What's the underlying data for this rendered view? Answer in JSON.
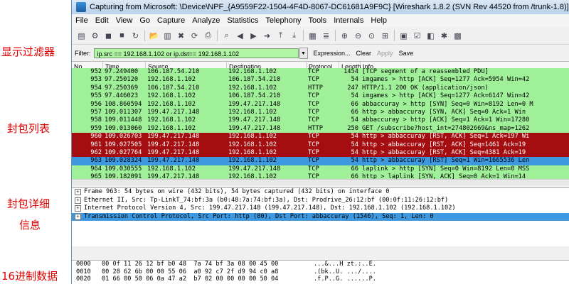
{
  "annotations": {
    "filter": "显示过滤器",
    "list": "封包列表",
    "detail_1": "封包详细",
    "detail_2": "信息",
    "hex": "16进制数据"
  },
  "window": {
    "title": "Capturing from Microsoft: \\Device\\NPF_{A9559F22-1504-4F4D-8067-DC61681A9F9C}   [Wireshark 1.8.2  (SVN Rev 44520 from /trunk-1.8)]"
  },
  "menu": [
    "File",
    "Edit",
    "View",
    "Go",
    "Capture",
    "Analyze",
    "Statistics",
    "Telephony",
    "Tools",
    "Internals",
    "Help"
  ],
  "toolbar_icons": [
    "interface-list-icon",
    "capture-options-icon",
    "start-capture-icon",
    "stop-capture-icon",
    "restart-capture-icon",
    "open-file-icon",
    "save-file-icon",
    "close-file-icon",
    "reload-icon",
    "print-icon",
    "find-packet-icon",
    "go-back-icon",
    "go-forward-icon",
    "go-to-packet-icon",
    "go-first-icon",
    "go-last-icon",
    "colorize-icon",
    "auto-scroll-icon",
    "zoom-in-icon",
    "zoom-out-icon",
    "normal-size-icon",
    "resize-columns-icon",
    "capture-filters-icon",
    "display-filters-icon",
    "coloring-rules-icon",
    "preferences-icon",
    "help-icon"
  ],
  "filter": {
    "label": "Filter:",
    "value": "ip.src == 192.168.1.102 or ip.dst== 192.168.1.102",
    "expression": "Expression...",
    "clear": "Clear",
    "apply": "Apply",
    "save": "Save",
    "input_bg": "#aff5a4"
  },
  "columns": [
    "No.",
    "Time",
    "Source",
    "Destination",
    "Protocol",
    "Length",
    "Info"
  ],
  "row_colors": {
    "green": "#a0f09a",
    "red": "#a50e10",
    "blue": "#3d98e0"
  },
  "packets": [
    {
      "no": "952",
      "time": "97.249400",
      "src": "106.187.54.210",
      "dst": "192.168.1.102",
      "proto": "TCP",
      "len": "1454",
      "info": "[TCP segment of a reassembled PDU]",
      "color": "green"
    },
    {
      "no": "953",
      "time": "97.250120",
      "src": "192.168.1.102",
      "dst": "106.187.54.210",
      "proto": "TCP",
      "len": "54",
      "info": "imgames > http [ACK] Seq=1277 Ack=5954 Win=42",
      "color": "green"
    },
    {
      "no": "954",
      "time": "97.250369",
      "src": "106.187.54.210",
      "dst": "192.168.1.102",
      "proto": "HTTP",
      "len": "247",
      "info": "HTTP/1.1 200 OK  (application/json)",
      "color": "green"
    },
    {
      "no": "955",
      "time": "97.446023",
      "src": "192.168.1.102",
      "dst": "106.187.54.210",
      "proto": "TCP",
      "len": "54",
      "info": "imgames > http [ACK] Seq=1277 Ack=6147 Win=42",
      "color": "green"
    },
    {
      "no": "956",
      "time": "108.860594",
      "src": "192.168.1.102",
      "dst": "199.47.217.148",
      "proto": "TCP",
      "len": "66",
      "info": "abbaccuray > http [SYN] Seq=0 Win=8192 Len=0 M",
      "color": "green"
    },
    {
      "no": "957",
      "time": "109.011307",
      "src": "199.47.217.148",
      "dst": "192.168.1.102",
      "proto": "TCP",
      "len": "66",
      "info": "http > abbaccuray [SYN, ACK] Seq=0 Ack=1 Win",
      "color": "green"
    },
    {
      "no": "958",
      "time": "109.011448",
      "src": "192.168.1.102",
      "dst": "199.47.217.148",
      "proto": "TCP",
      "len": "54",
      "info": "abbaccuray > http [ACK] Seq=1 Ack=1 Win=17280",
      "color": "green"
    },
    {
      "no": "959",
      "time": "109.013060",
      "src": "192.168.1.102",
      "dst": "199.47.217.148",
      "proto": "HTTP",
      "len": "250",
      "info": "GET /subscribe?host_int=274802669&ns_map=1262",
      "color": "green"
    },
    {
      "no": "960",
      "time": "109.026703",
      "src": "199.47.217.148",
      "dst": "192.168.1.102",
      "proto": "TCP",
      "len": "54",
      "info": "http > abbaccuray [RST, ACK] Seq=1 Ack=197 Wi",
      "color": "red"
    },
    {
      "no": "961",
      "time": "109.027505",
      "src": "199.47.217.148",
      "dst": "192.168.1.102",
      "proto": "TCP",
      "len": "54",
      "info": "http > abbaccuray [RST, ACK] Seq=1461 Ack=19",
      "color": "red"
    },
    {
      "no": "962",
      "time": "109.027764",
      "src": "199.47.217.148",
      "dst": "192.168.1.102",
      "proto": "TCP",
      "len": "54",
      "info": "http > abbaccuray [RST, ACK] Seq=4381 Ack=19",
      "color": "red"
    },
    {
      "no": "963",
      "time": "109.028324",
      "src": "199.47.217.148",
      "dst": "192.168.1.102",
      "proto": "TCP",
      "len": "54",
      "info": "http > abbaccuray [RST] Seq=1 Win=1665536 Len",
      "color": "blue"
    },
    {
      "no": "964",
      "time": "109.030555",
      "src": "192.168.1.102",
      "dst": "199.47.217.148",
      "proto": "TCP",
      "len": "66",
      "info": "laplink > http [SYN] Seq=0 Win=8192 Len=0 MSS",
      "color": "green"
    },
    {
      "no": "965",
      "time": "109.182091",
      "src": "199.47.217.148",
      "dst": "192.168.1.102",
      "proto": "TCP",
      "len": "66",
      "info": "http > laplink [SYN, ACK] Seq=0 Ack=1 Win=14",
      "color": "green"
    }
  ],
  "details": [
    {
      "text": "Frame 963: 54 bytes on wire (432 bits), 54 bytes captured (432 bits) on interface 0",
      "selected": false
    },
    {
      "text": "Ethernet II, Src: Tp-LinkT_74:bf:3a (b0:48:7a:74:bf:3a), Dst: Prodrive_26:12:bf (00:0f:11:26:12:bf)",
      "selected": false
    },
    {
      "text": "Internet Protocol Version 4, Src: 199.47.217.148 (199.47.217.148), Dst: 192.168.1.102 (192.168.1.102)",
      "selected": false
    },
    {
      "text": "Transmission Control Protocol, Src Port: http (80), Dst Port: abbaccuray (1546), Seq: 1, Len: 0",
      "selected": true
    }
  ],
  "hex": [
    {
      "off": "0000",
      "bytes": "00 0f 11 26 12 bf b0 48  7a 74 bf 3a 08 00 45 00",
      "ascii": "...&...H zt.:..E."
    },
    {
      "off": "0010",
      "bytes": "00 28 62 6b 00 00 55 06  a0 92 c7 2f d9 94 c0 a8",
      "ascii": ".(bk..U. .../...."
    },
    {
      "off": "0020",
      "bytes": "01 66 00 50 06 0a 47 a2  b7 02 00 00 00 00 50 04",
      "ascii": ".f.P..G. ......P."
    }
  ]
}
